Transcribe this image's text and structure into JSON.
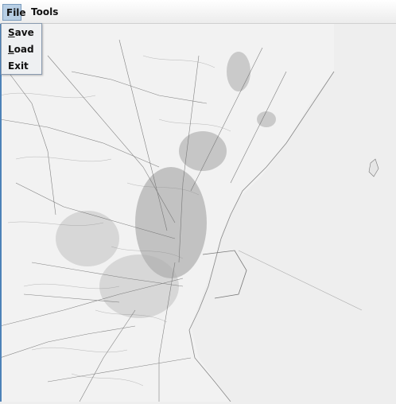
{
  "menubar": {
    "file": "File",
    "tools": "Tools"
  },
  "file_menu": {
    "save": {
      "mnemonic": "S",
      "rest": "ave"
    },
    "load": {
      "mnemonic": "L",
      "rest": "oad"
    },
    "exit": "Exit"
  },
  "map": {
    "description_icon": "street-network-map",
    "colors": {
      "background": "#eeeeee",
      "streets": "#555555",
      "dense": "#333333"
    }
  }
}
